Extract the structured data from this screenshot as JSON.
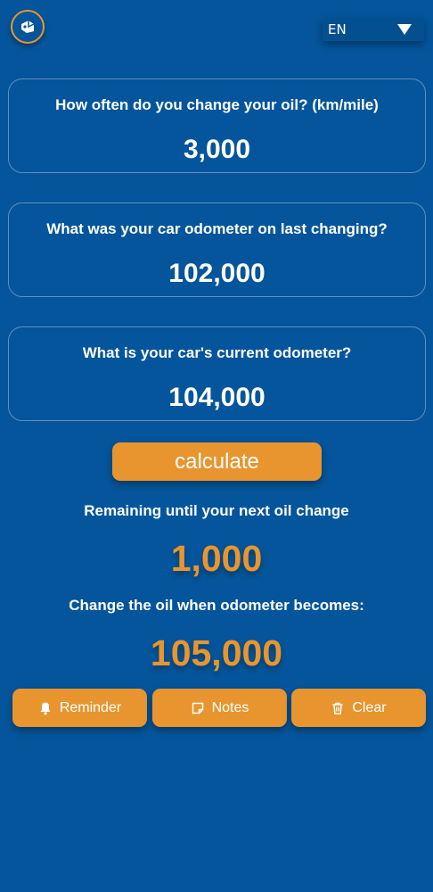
{
  "header": {
    "logo_icon": "oil-can-icon",
    "language": "EN"
  },
  "questions": [
    {
      "label": "How often do you change your oil? (km/mile)",
      "value": "3,000"
    },
    {
      "label": "What was your car odometer on last changing?",
      "value": "102,000"
    },
    {
      "label": "What is your car's current odometer?",
      "value": "104,000"
    }
  ],
  "calculate_label": "calculate",
  "results": {
    "remaining_label": "Remaining until your next oil change",
    "remaining_value": "1,000",
    "change_at_label": "Change the oil when odometer becomes:",
    "change_at_value": "105,000"
  },
  "actions": {
    "reminder": {
      "label": "Reminder",
      "icon": "bell-icon"
    },
    "notes": {
      "label": "Notes",
      "icon": "note-icon"
    },
    "clear": {
      "label": "Clear",
      "icon": "trash-icon"
    }
  },
  "colors": {
    "background": "#04559b",
    "accent": "#e8952f",
    "card_border": "#5f8fbd"
  }
}
